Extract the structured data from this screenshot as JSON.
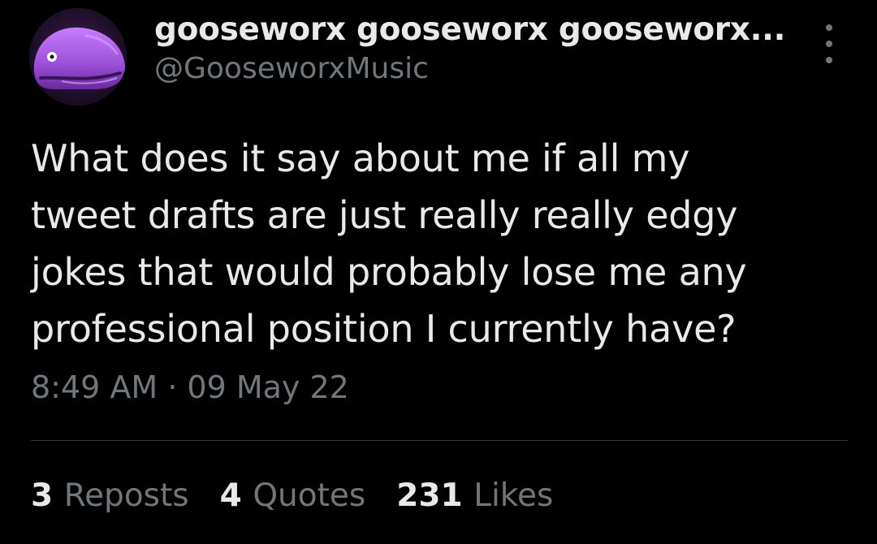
{
  "author": {
    "display_name": "gooseworx gooseworx gooseworx...",
    "handle": "@GooseworxMusic"
  },
  "tweet": {
    "text_lines": [
      "What does it say about me if all my",
      "tweet drafts are just really really edgy",
      "jokes that would probably lose me any",
      "professional position I currently have?"
    ],
    "timestamp": "8:49 AM · 09 May 22"
  },
  "stats": {
    "reposts_count": "3",
    "reposts_label": "Reposts",
    "quotes_count": "4",
    "quotes_label": "Quotes",
    "likes_count": "231",
    "likes_label": "Likes"
  },
  "colors": {
    "background": "#000000",
    "primary_text": "#e7e9ea",
    "secondary_text": "#71767b",
    "divider": "#2f3336",
    "avatar_purple": "#a855f7"
  },
  "icons": {
    "more": "more-vertical-icon",
    "avatar": "purple-whale-avatar"
  }
}
